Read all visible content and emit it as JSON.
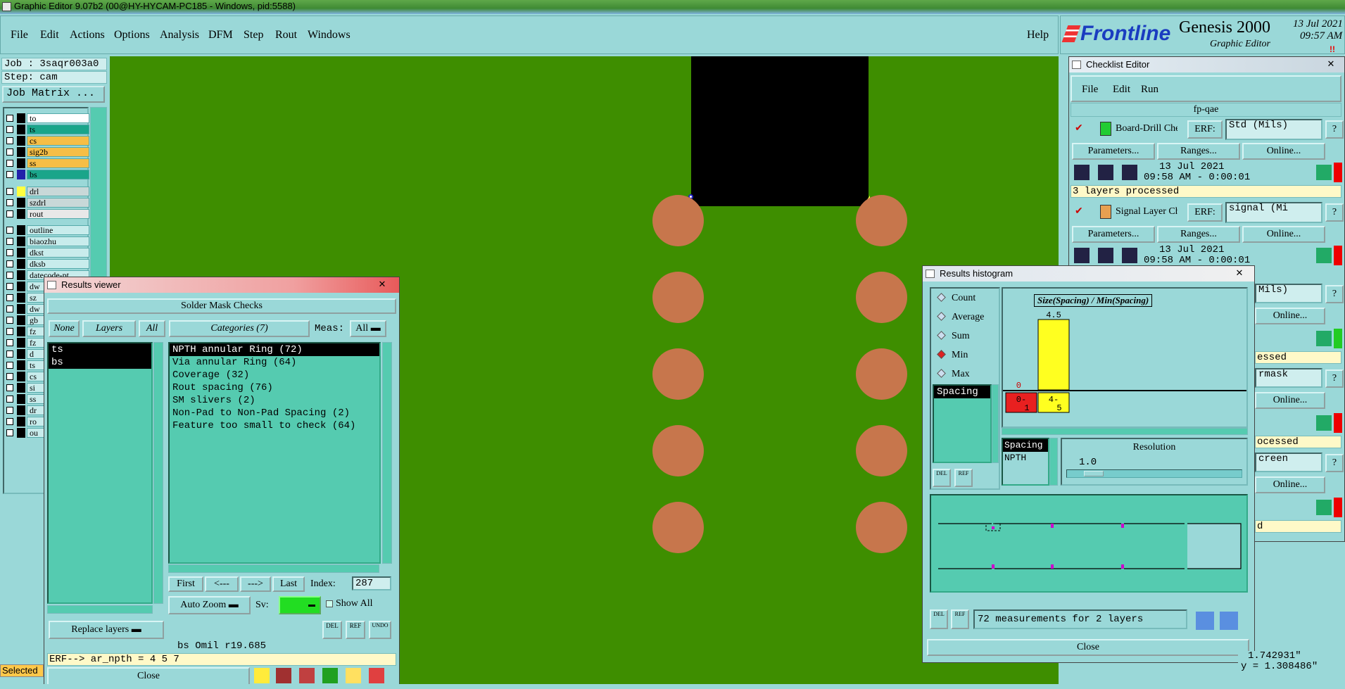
{
  "window": {
    "title": "Graphic Editor 9.07b2 (00@HY-HYCAM-PC185 - Windows, pid:5588)"
  },
  "menu": {
    "items": [
      "File",
      "Edit",
      "Actions",
      "Options",
      "Analysis",
      "DFM",
      "Step",
      "Rout",
      "Windows"
    ],
    "help": "Help"
  },
  "logo": {
    "brand": "Frontline",
    "product": "Genesis 2000",
    "subtitle": "Graphic Editor",
    "date": "13 Jul 2021",
    "time": "09:57 AM"
  },
  "left": {
    "job": "Job : 3saqr003a0",
    "step": "Step: cam",
    "job_matrix": "Job Matrix ..."
  },
  "layers": [
    {
      "name": "to",
      "color": "#ffffff"
    },
    {
      "name": "ts",
      "color": "#1aa58a"
    },
    {
      "name": "cs",
      "color": "#f6be46"
    },
    {
      "name": "sig2b",
      "color": "#f6be46"
    },
    {
      "name": "ss",
      "color": "#f6be46"
    },
    {
      "name": "bs",
      "color": "#1aa58a"
    },
    {
      "name": "drl",
      "color": "#c8d8d8"
    },
    {
      "name": "szdrl",
      "color": "#c8d8d8"
    },
    {
      "name": "rout",
      "color": "#e8e8e8"
    },
    {
      "name": "outline",
      "color": "#c8ecec"
    },
    {
      "name": "biaozhu",
      "color": "#c8ecec"
    },
    {
      "name": "dkst",
      "color": "#c8ecec"
    },
    {
      "name": "dksb",
      "color": "#c8ecec"
    },
    {
      "name": "datecode-pt",
      "color": "#c8ecec"
    },
    {
      "name": "dw",
      "color": "#c8ecec"
    },
    {
      "name": "sz",
      "color": "#c8ecec"
    },
    {
      "name": "dw",
      "color": "#c8ecec"
    },
    {
      "name": "gb",
      "color": "#c8ecec"
    },
    {
      "name": "fz",
      "color": "#c8ecec"
    },
    {
      "name": "fz",
      "color": "#c8ecec"
    },
    {
      "name": "d",
      "color": "#c8ecec"
    },
    {
      "name": "ts",
      "color": "#c8ecec"
    },
    {
      "name": "cs",
      "color": "#c8ecec"
    },
    {
      "name": "si",
      "color": "#c8ecec"
    },
    {
      "name": "ss",
      "color": "#c8ecec"
    },
    {
      "name": "dr",
      "color": "#c8ecec"
    },
    {
      "name": "ro",
      "color": "#c8ecec"
    },
    {
      "name": "ou",
      "color": "#c8ecec"
    }
  ],
  "selected_label": "Selected",
  "results_viewer": {
    "title": "Results viewer",
    "heading": "Solder Mask Checks",
    "none": "None",
    "layers": "Layers",
    "all": "All",
    "categories_label": "Categories (7)",
    "meas_label": "Meas:",
    "meas_value": "All",
    "layer_list": [
      "ts",
      "bs"
    ],
    "categories": [
      "NPTH annular Ring (72)",
      "Via annular Ring (64)",
      "Coverage (32)",
      "Rout spacing (76)",
      "SM slivers (2)",
      "Non-Pad to Non-Pad Spacing (2)",
      "Feature too small to check (64)"
    ],
    "first": "First",
    "prev": "<---",
    "next": "--->",
    "last": "Last",
    "index_label": "Index:",
    "index_value": "287",
    "auto_zoom": "Auto Zoom",
    "sv_label": "Sv:",
    "show_all": "Show All",
    "replace_layers": "Replace layers",
    "del": "DEL",
    "ref": "REF",
    "undo": "UNDO",
    "info": "bs Omil  r19.685",
    "erf": "ERF--> ar_npth = 4 5 7",
    "close": "Close"
  },
  "histogram": {
    "title": "Results histogram",
    "options": [
      "Count",
      "Average",
      "Sum",
      "Min",
      "Max"
    ],
    "selected_option": "Min",
    "chart_title": "Size(Spacing) / Min(Spacing)",
    "list_items": [
      "Spacing"
    ],
    "bars": [
      {
        "label_top": "0-",
        "label_bottom": "1",
        "value": 0,
        "color": "#e82020"
      },
      {
        "label_top": "4-",
        "label_bottom": "5",
        "value": 4.5,
        "color": "#ffff20"
      }
    ],
    "list2": [
      "Spacing",
      "NPTH"
    ],
    "resolution_label": "Resolution",
    "resolution_value": "1.0",
    "del": "DEL",
    "ref": "REF",
    "measurements": "72 measurements for 2 layers",
    "close": "Close"
  },
  "checklist": {
    "title": "Checklist Editor",
    "menu": [
      "File",
      "Edit",
      "Run"
    ],
    "name": "fp-qae",
    "checks": [
      {
        "name": "Board-Drill Che",
        "erf": "ERF:",
        "erf_value": "Std (Mils)",
        "date": "13 Jul 2021",
        "time": "09:58 AM - 0:00:01",
        "status": "3 layers processed"
      },
      {
        "name": "Signal Layer Ch",
        "erf": "ERF:",
        "erf_value": "signal (Mi",
        "date": "13 Jul 2021",
        "time": "09:58 AM - 0:00:01",
        "status": ""
      }
    ],
    "parameters": "Parameters...",
    "ranges": "Ranges...",
    "online": "Online...",
    "hidden_fields": [
      "Mils)",
      "rmask",
      "creen"
    ],
    "hidden_status": [
      "essed",
      "ocessed",
      "d"
    ]
  },
  "coords": {
    "x": "1.742931\"",
    "y": "y = 1.308486\""
  }
}
